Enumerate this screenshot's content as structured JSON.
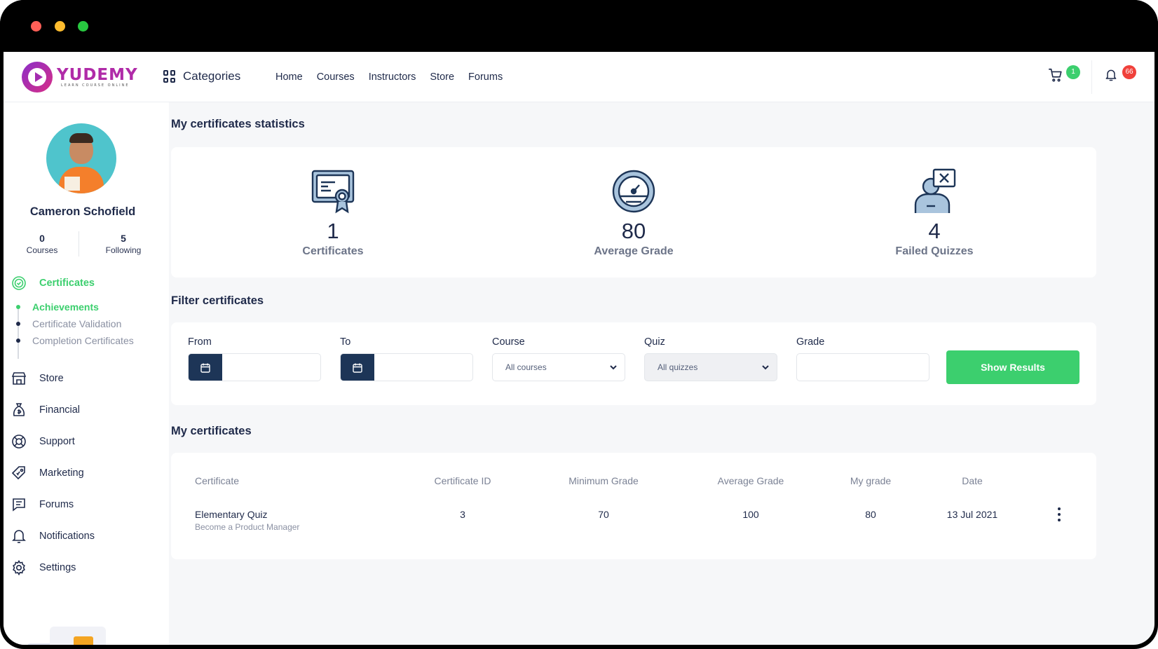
{
  "brand": {
    "name": "YUDEMY",
    "tagline": "LEARN COURSE ONLINE"
  },
  "header": {
    "categories_label": "Categories",
    "nav": [
      "Home",
      "Courses",
      "Instructors",
      "Store",
      "Forums"
    ],
    "cart_count": "1",
    "notification_count": "66",
    "colors": {
      "cart_badge": "#3ccf6e",
      "bell_badge": "#f0413b"
    }
  },
  "sidebar": {
    "user_name": "Cameron Schofield",
    "stats": [
      {
        "value": "0",
        "label": "Courses"
      },
      {
        "value": "5",
        "label": "Following"
      }
    ],
    "certificates_label": "Certificates",
    "subitems": [
      "Achievements",
      "Certificate Validation",
      "Completion Certificates"
    ],
    "items": [
      {
        "label": "Store",
        "icon": "store-icon"
      },
      {
        "label": "Financial",
        "icon": "money-bag-icon"
      },
      {
        "label": "Support",
        "icon": "lifebuoy-icon"
      },
      {
        "label": "Marketing",
        "icon": "tag-icon"
      },
      {
        "label": "Forums",
        "icon": "chat-icon"
      },
      {
        "label": "Notifications",
        "icon": "bell-icon"
      },
      {
        "label": "Settings",
        "icon": "gear-icon"
      }
    ]
  },
  "stats_section": {
    "title": "My certificates statistics",
    "cards": [
      {
        "value": "1",
        "label": "Certificates",
        "icon": "certificate-icon"
      },
      {
        "value": "80",
        "label": "Average Grade",
        "icon": "gauge-icon"
      },
      {
        "value": "4",
        "label": "Failed Quizzes",
        "icon": "failed-quiz-icon"
      }
    ]
  },
  "filter": {
    "title": "Filter certificates",
    "from_label": "From",
    "to_label": "To",
    "course_label": "Course",
    "course_value": "All courses",
    "quiz_label": "Quiz",
    "quiz_value": "All quizzes",
    "grade_label": "Grade",
    "button_label": "Show Results"
  },
  "certificates": {
    "title": "My certificates",
    "columns": [
      "Certificate",
      "Certificate ID",
      "Minimum Grade",
      "Average Grade",
      "My grade",
      "Date"
    ],
    "rows": [
      {
        "name": "Elementary Quiz",
        "course": "Become a Product Manager",
        "id": "3",
        "min_grade": "70",
        "avg_grade": "100",
        "my_grade": "80",
        "date": "13 Jul 2021"
      }
    ]
  },
  "colors": {
    "accent": "#3ccf6e",
    "navy": "#1d3557",
    "brand": "#b02ba8"
  }
}
